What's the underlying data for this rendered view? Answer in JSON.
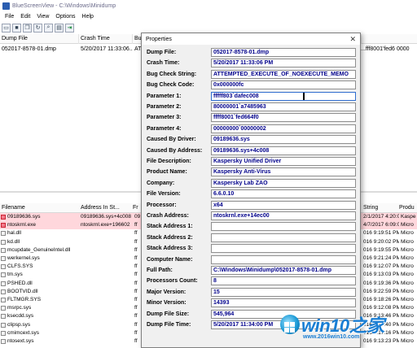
{
  "window": {
    "title": "BlueScreenView - C:\\Windows\\Minidump",
    "icon": "app-icon"
  },
  "menu": [
    "File",
    "Edit",
    "View",
    "Options",
    "Help"
  ],
  "toolbar": {
    "buttons": [
      {
        "icon": "properties-icon",
        "glyph": "▭"
      },
      {
        "icon": "save-icon",
        "glyph": "■"
      },
      {
        "icon": "copy-icon",
        "glyph": "❐"
      },
      {
        "icon": "refresh-icon",
        "glyph": "↻"
      },
      {
        "icon": "find-icon",
        "glyph": "⌕"
      },
      {
        "icon": "folder-icon",
        "glyph": "▤"
      },
      {
        "icon": "exit-icon",
        "glyph": "⇥"
      }
    ]
  },
  "upper_list": {
    "headers": [
      "Dump File",
      "Crash Time",
      "Bu",
      "meter 3",
      "Para"
    ],
    "rows": [
      {
        "dump_file": "052017-8578-01.dmp",
        "crash_time": "5/20/2017 11:33:06...",
        "bug": "AT",
        "param3": "...fff8001'fed664f0",
        "param4": "0000"
      }
    ]
  },
  "lower_list": {
    "headers": [
      "Filename",
      "Address In St...",
      "Fr",
      "String",
      "Produ"
    ],
    "rows": [
      {
        "filename": "09189636.sys",
        "address": "09189636.sys+4c008",
        "fr": "09",
        "time": "2/1/2017 4:20:03 AM",
        "product": "Kaspe",
        "highlight": true
      },
      {
        "filename": "ntoskrnl.exe",
        "address": "ntoskrnl.exe+196602",
        "fr": "ff",
        "time": "4/7/2017 6:09:04 AM",
        "product": "Micro",
        "highlight": true
      },
      {
        "filename": "hal.dll",
        "address": "",
        "fr": "ff",
        "time": "016 9:19:51 PM",
        "product": "Micro",
        "highlight": false
      },
      {
        "filename": "kd.dll",
        "address": "",
        "fr": "ff",
        "time": "016 9:20:02 PM",
        "product": "Micro",
        "highlight": false
      },
      {
        "filename": "mcupdate_GenuineIntel.dll",
        "address": "",
        "fr": "ff",
        "time": "016 9:19:55 PM",
        "product": "Micro",
        "highlight": false
      },
      {
        "filename": "werkernel.sys",
        "address": "",
        "fr": "ff",
        "time": "016 9:21:24 PM",
        "product": "Micro",
        "highlight": false
      },
      {
        "filename": "CLFS.SYS",
        "address": "",
        "fr": "ff",
        "time": "016 9:12:07 PM",
        "product": "Micro",
        "highlight": false
      },
      {
        "filename": "tm.sys",
        "address": "",
        "fr": "ff",
        "time": "016 9:13:03 PM",
        "product": "Micro",
        "highlight": false
      },
      {
        "filename": "PSHED.dll",
        "address": "",
        "fr": "ff",
        "time": "016 9:19:36 PM",
        "product": "Micro",
        "highlight": false
      },
      {
        "filename": "BOOTVID.dll",
        "address": "",
        "fr": "ff",
        "time": "016 9:22:59 PM",
        "product": "Micro",
        "highlight": false
      },
      {
        "filename": "FLTMGR.SYS",
        "address": "",
        "fr": "ff",
        "time": "016 9:18:26 PM",
        "product": "Micro",
        "highlight": false
      },
      {
        "filename": "msrpc.sys",
        "address": "",
        "fr": "ff",
        "time": "016 9:12:08 PM",
        "product": "Micro",
        "highlight": false
      },
      {
        "filename": "ksecdd.sys",
        "address": "",
        "fr": "ff",
        "time": "016 9:13:46 PM",
        "product": "Micro",
        "highlight": false
      },
      {
        "filename": "clipsp.sys",
        "address": "",
        "fr": "ff",
        "time": "016 9:14:40 PM",
        "product": "Micro",
        "highlight": false
      },
      {
        "filename": "cmimcext.sys",
        "address": "",
        "fr": "ff",
        "time": "016 9:17:16 PM",
        "product": "Micro",
        "highlight": false
      },
      {
        "filename": "ntosext.sys",
        "address": "",
        "fr": "ff",
        "time": "016 9:13:23 PM",
        "product": "Micro",
        "highlight": false
      }
    ]
  },
  "properties": {
    "title": "Properties",
    "close_glyph": "✕",
    "fields": [
      {
        "label": "Dump File:",
        "value": "052017-8578-01.dmp"
      },
      {
        "label": "Crash Time:",
        "value": "5/20/2017 11:33:06 PM"
      },
      {
        "label": "Bug Check String:",
        "value": "ATTEMPTED_EXECUTE_OF_NOEXECUTE_MEMO"
      },
      {
        "label": "Bug Check Code:",
        "value": "0x000000fc"
      },
      {
        "label": "Parameter 1:",
        "value": "fffff803`dafec008",
        "focused": true
      },
      {
        "label": "Parameter 2:",
        "value": "80000001`a7485963"
      },
      {
        "label": "Parameter 3:",
        "value": "ffff8001`fed664f0"
      },
      {
        "label": "Parameter 4:",
        "value": "00000000`00000002"
      },
      {
        "label": "Caused By Driver:",
        "value": "09189636.sys"
      },
      {
        "label": "Caused By Address:",
        "value": "09189636.sys+4c008"
      },
      {
        "label": "File Description:",
        "value": "Kaspersky Unified Driver"
      },
      {
        "label": "Product Name:",
        "value": "Kaspersky Anti-Virus"
      },
      {
        "label": "Company:",
        "value": "Kaspersky Lab ZAO"
      },
      {
        "label": "File Version:",
        "value": "6.6.0.10"
      },
      {
        "label": "Processor:",
        "value": "x64"
      },
      {
        "label": "Crash Address:",
        "value": "ntoskrnl.exe+14ec00"
      },
      {
        "label": "Stack Address 1:",
        "value": ""
      },
      {
        "label": "Stack Address 2:",
        "value": ""
      },
      {
        "label": "Stack Address 3:",
        "value": ""
      },
      {
        "label": "Computer Name:",
        "value": ""
      },
      {
        "label": "Full Path:",
        "value": "C:\\Windows\\Minidump\\052017-8578-01.dmp"
      },
      {
        "label": "Processors Count:",
        "value": "8"
      },
      {
        "label": "Major Version:",
        "value": "15"
      },
      {
        "label": "Minor Version:",
        "value": "14393"
      },
      {
        "label": "Dump File Size:",
        "value": "545,964"
      },
      {
        "label": "Dump File Time:",
        "value": "5/20/2017 11:34:00 PM"
      }
    ]
  },
  "watermark": {
    "brand": "win10",
    "suffix": "之家",
    "url": "www.2016win10.com"
  },
  "colors": {
    "highlight_row": "#ffd7dc",
    "value_text": "#00008b",
    "watermark": "#1a7ed3"
  }
}
